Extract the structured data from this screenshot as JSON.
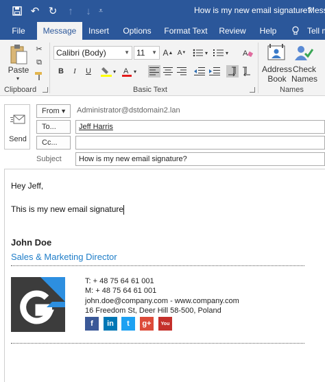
{
  "window": {
    "title": "How is my new email signature?",
    "title_dash": "-",
    "title_suffix": "Mess"
  },
  "tabs": [
    {
      "label": "File"
    },
    {
      "label": "Message"
    },
    {
      "label": "Insert"
    },
    {
      "label": "Options"
    },
    {
      "label": "Format Text"
    },
    {
      "label": "Review"
    },
    {
      "label": "Help"
    },
    {
      "label": "Tell m"
    }
  ],
  "ribbon": {
    "clipboard": {
      "paste_label": "Paste",
      "group_label": "Clipboard"
    },
    "basic_text": {
      "font_name": "Calibri (Body)",
      "font_size": "11",
      "bold": "B",
      "italic": "I",
      "underline": "U",
      "group_label": "Basic Text"
    },
    "names": {
      "address_book_line1": "Address",
      "address_book_line2": "Book",
      "check_names_line1": "Check",
      "check_names_line2": "Names",
      "group_label": "Names"
    }
  },
  "compose": {
    "send_label": "Send",
    "from_label": "From",
    "from_value": "Administrator@dstdomain2.lan",
    "to_label": "To...",
    "to_value": "Jeff Harris",
    "cc_label": "Cc...",
    "cc_value": "",
    "subject_label": "Subject",
    "subject_value": "How is my new email signature?"
  },
  "body": {
    "greeting": "Hey Jeff,",
    "line1": "This is my new email signature"
  },
  "signature": {
    "name": "John Doe",
    "title": "Sales & Marketing Director",
    "phone": "T: + 48 75 64 61 001",
    "mobile": "M: + 48 75 64 61 001",
    "email_web": "john.doe@company.com - www.company.com",
    "address": "16 Freedom St, Deer Hill 58-500, Poland",
    "social": [
      {
        "icon": "facebook-icon",
        "glyph": "f",
        "color": "#3b5998"
      },
      {
        "icon": "linkedin-icon",
        "glyph": "in",
        "color": "#0077b5"
      },
      {
        "icon": "twitter-icon",
        "glyph": "t",
        "color": "#1da1f2"
      },
      {
        "icon": "google-plus-icon",
        "glyph": "g+",
        "color": "#dd4b39"
      },
      {
        "icon": "youtube-icon",
        "glyph": "You",
        "color": "#c4302b"
      }
    ]
  },
  "colors": {
    "accent": "#2b579a",
    "link_blue": "#1e7dc8"
  }
}
